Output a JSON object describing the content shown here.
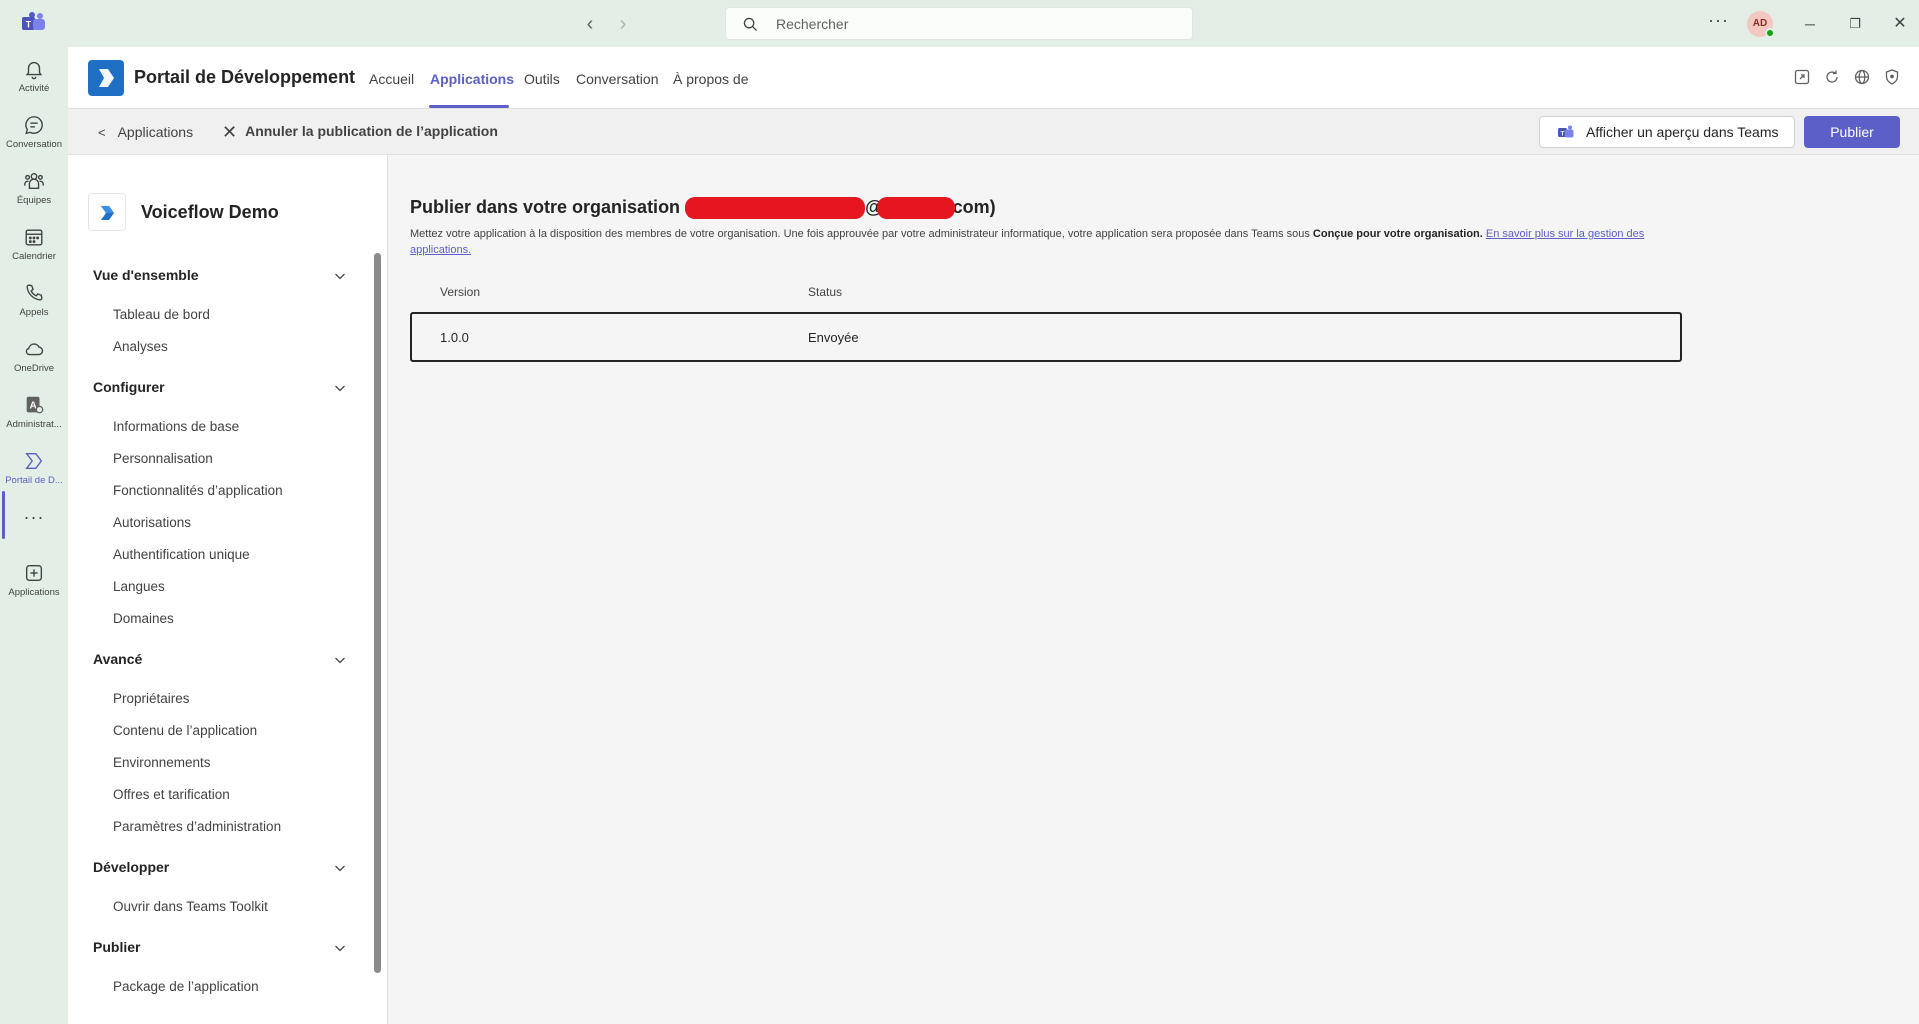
{
  "titlebar": {
    "search_placeholder": "Rechercher",
    "avatar_initials": "AD"
  },
  "rail": {
    "items": [
      {
        "label": "Activité",
        "icon": "bell-icon"
      },
      {
        "label": "Conversation",
        "icon": "chat-icon"
      },
      {
        "label": "Équipes",
        "icon": "teams-icon"
      },
      {
        "label": "Calendrier",
        "icon": "calendar-icon"
      },
      {
        "label": "Appels",
        "icon": "phone-icon"
      },
      {
        "label": "OneDrive",
        "icon": "cloud-icon"
      },
      {
        "label": "Administrat...",
        "icon": "admin-icon"
      },
      {
        "label": "Portail de D...",
        "icon": "dev-portal-icon"
      },
      {
        "label": "Applications",
        "icon": "add-app-icon"
      }
    ],
    "active_index": 7
  },
  "header": {
    "title": "Portail de Développement",
    "tabs": [
      {
        "label": "Accueil"
      },
      {
        "label": "Applications"
      },
      {
        "label": "Outils"
      },
      {
        "label": "Conversation"
      },
      {
        "label": "À propos de"
      }
    ],
    "active_tab": 1
  },
  "toolbar": {
    "back_label": "Applications",
    "unpublish_label": "Annuler la publication de l’application",
    "preview_label": "Afficher un aperçu dans Teams",
    "publish_label": "Publier"
  },
  "sidenav": {
    "project_name": "Voiceflow Demo",
    "sections": [
      {
        "title": "Vue d'ensemble",
        "items": [
          "Tableau de bord",
          "Analyses"
        ]
      },
      {
        "title": "Configurer",
        "items": [
          "Informations de base",
          "Personnalisation",
          "Fonctionnalités d’application",
          "Autorisations",
          "Authentification unique",
          "Langues",
          "Domaines"
        ]
      },
      {
        "title": "Avancé",
        "items": [
          "Propriétaires",
          "Contenu de l’application",
          "Environnements",
          "Offres et tarification",
          "Paramètres d’administration"
        ]
      },
      {
        "title": "Développer",
        "items": [
          "Ouvrir dans Teams Toolkit"
        ]
      },
      {
        "title": "Publier",
        "items": [
          "Package de l’application"
        ]
      }
    ]
  },
  "main": {
    "title_prefix": "Publier dans votre organisation (",
    "title_at": "@",
    "title_suffix": "com)",
    "desc_text": "Mettez votre application à la disposition des membres de votre organisation. Une fois approuvée par votre administrateur informatique, votre application sera proposée dans Teams sous ",
    "desc_bold": "Conçue pour votre organisation.",
    "desc_link": "En savoir plus sur la gestion des applications.",
    "table": {
      "headers": [
        "Version",
        "Status"
      ],
      "rows": [
        [
          "1.0.0",
          "Envoyée"
        ]
      ]
    }
  },
  "colors": {
    "accent": "#5b5fc7",
    "rail_bg": "#e3efe6",
    "app_logo": "#1f6fc5",
    "redaction": "#e5161f"
  }
}
